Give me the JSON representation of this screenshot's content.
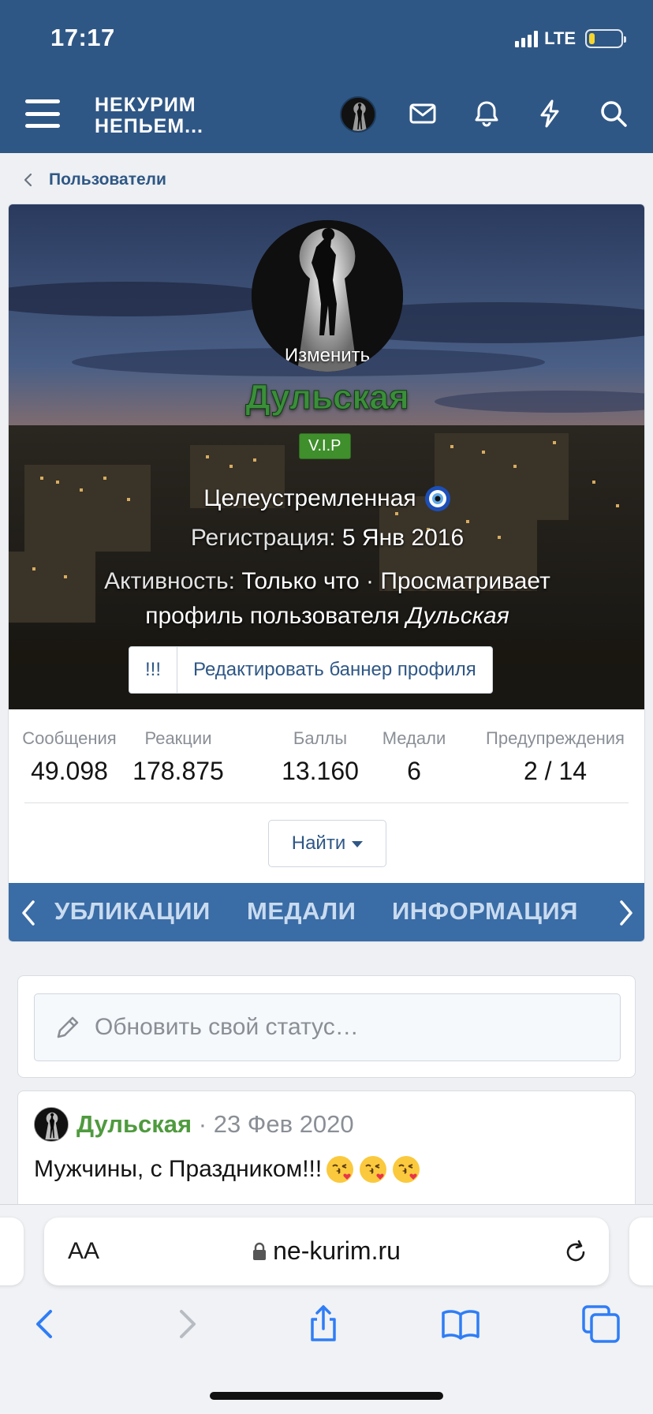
{
  "status_bar": {
    "time": "17:17",
    "network": "LTE"
  },
  "header": {
    "logo_line1": "НЕКУРИМ",
    "logo_line2": "НЕПЬЕМ..."
  },
  "breadcrumb": {
    "label": "Пользователи"
  },
  "profile": {
    "avatar_change_label": "Изменить",
    "username": "Дульская",
    "badge": "V.I.P",
    "user_title": "Целеустремленная",
    "registration_label": "Регистрация:",
    "registration_value": "5 Янв 2016",
    "activity_label": "Активность:",
    "activity_value": "Только что · Просматривает профиль пользователя",
    "activity_user": "Дульская",
    "banner_buttons": {
      "exclaim": "!!!",
      "edit_banner": "Редактировать баннер профиля"
    },
    "stats": [
      {
        "label": "Сообщения",
        "value": "49.098"
      },
      {
        "label": "Реакции",
        "value": "178.875"
      },
      {
        "label": "Баллы",
        "value": "13.160"
      },
      {
        "label": "Медали",
        "value": "6"
      },
      {
        "label": "Предупреждения",
        "value": "2 / 14"
      }
    ],
    "find_button": "Найти"
  },
  "tabs": [
    "УБЛИКАЦИИ",
    "МЕДАЛИ",
    "ИНФОРМАЦИЯ"
  ],
  "status_update": {
    "placeholder": "Обновить свой статус…"
  },
  "post": {
    "author": "Дульская",
    "date": "23 Фев 2020",
    "text": "Мужчины, с Праздником!!!"
  },
  "browser": {
    "aa_label": "AA",
    "url": "ne-kurim.ru"
  },
  "colors": {
    "header_bg": "#2f5785",
    "tabs_bg": "#3a6ca6",
    "username_green": "#3b8e3a",
    "vip_green": "#3f8f2c",
    "link_blue": "#2f5785"
  }
}
